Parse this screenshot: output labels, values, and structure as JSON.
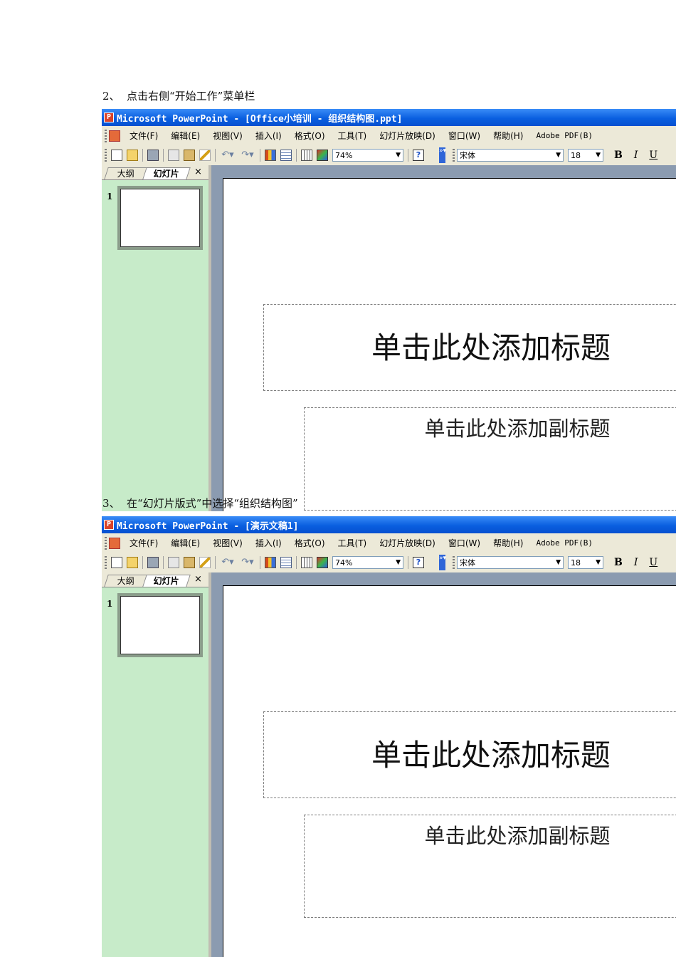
{
  "steps": [
    {
      "num": "2、",
      "text": "点击右侧“开始工作”菜单栏"
    },
    {
      "num": "3、",
      "text": "在“幻灯片版式”中选择“组织结构图”"
    }
  ],
  "screens": [
    {
      "window_title": "Microsoft PowerPoint - [Office小培训 - 组织结构图.ppt]",
      "menu": [
        "文件(F)",
        "编辑(E)",
        "视图(V)",
        "插入(I)",
        "格式(O)",
        "工具(T)",
        "幻灯片放映(D)",
        "窗口(W)",
        "帮助(H)",
        "Adobe PDF(B)"
      ],
      "zoom": "74%",
      "font": "宋体",
      "font_size": "18",
      "bold": "B",
      "italic": "I",
      "underline": "U",
      "tabs": {
        "outline": "大纲",
        "slides": "幻灯片",
        "close": "×"
      },
      "slide_number": "1",
      "title_placeholder": "单击此处添加标题",
      "subtitle_placeholder": "单击此处添加副标题"
    },
    {
      "window_title": "Microsoft PowerPoint - [演示文稿1]",
      "menu": [
        "文件(F)",
        "编辑(E)",
        "视图(V)",
        "插入(I)",
        "格式(O)",
        "工具(T)",
        "幻灯片放映(D)",
        "窗口(W)",
        "帮助(H)",
        "Adobe PDF(B)"
      ],
      "zoom": "74%",
      "font": "宋体",
      "font_size": "18",
      "bold": "B",
      "italic": "I",
      "underline": "U",
      "tabs": {
        "outline": "大纲",
        "slides": "幻灯片",
        "close": "×"
      },
      "slide_number": "1",
      "title_placeholder": "单击此处添加标题",
      "subtitle_placeholder": "单击此处添加副标题"
    }
  ],
  "colors": {
    "titlebar": "#0a5fe0",
    "thumbnail_pane": "#c7ebc9",
    "workspace": "#8b9bb0",
    "chrome": "#ece9d8"
  }
}
